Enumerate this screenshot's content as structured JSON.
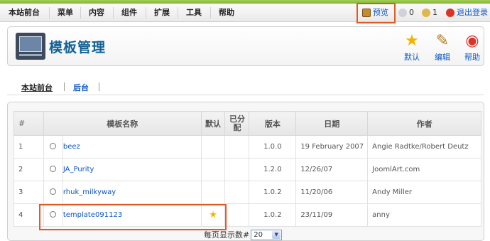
{
  "menu": {
    "items": [
      "本站前台",
      "菜单",
      "内容",
      "组件",
      "扩展",
      "工具",
      "帮助"
    ]
  },
  "status": {
    "preview": "预览",
    "messages": "0",
    "users": "1",
    "logout": "退出登录"
  },
  "toolbar": {
    "title": "模板管理",
    "default_label": "默认",
    "edit_label": "编辑",
    "help_label": "帮助"
  },
  "subnav": {
    "tabs": [
      "本站前台",
      "后台"
    ]
  },
  "table": {
    "headers": [
      "#",
      "模板名称",
      "默认",
      "已分配",
      "版本",
      "日期",
      "作者"
    ],
    "rows": [
      {
        "num": "1",
        "name": "beez",
        "is_default": false,
        "version": "1.0.0",
        "date": "19 February 2007",
        "author": "Angie Radtke/Robert Deutz"
      },
      {
        "num": "2",
        "name": "JA_Purity",
        "is_default": false,
        "version": "1.2.0",
        "date": "12/26/07",
        "author": "JoomlArt.com"
      },
      {
        "num": "3",
        "name": "rhuk_milkyway",
        "is_default": false,
        "version": "1.0.2",
        "date": "11/20/06",
        "author": "Andy Miller"
      },
      {
        "num": "4",
        "name": "template091123",
        "is_default": true,
        "version": "1.0.2",
        "date": "23/11/09",
        "author": "anny"
      }
    ]
  },
  "pager": {
    "label": "每页显示数#",
    "value": "20"
  },
  "colors": {
    "accent": "#0b55c4",
    "highlight": "#e05a26",
    "title": "#146295"
  }
}
